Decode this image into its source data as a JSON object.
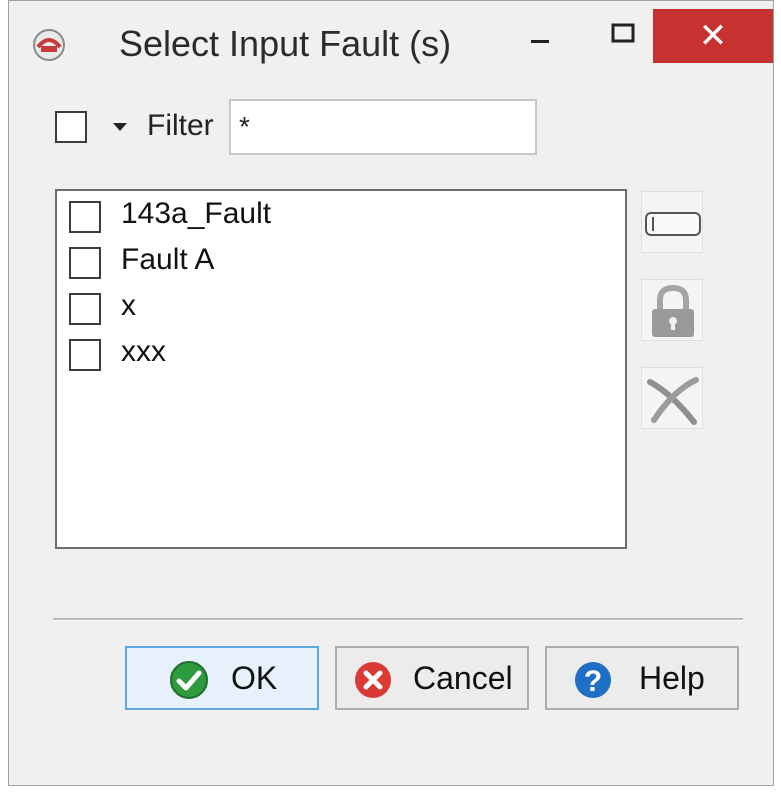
{
  "window": {
    "title": "Select Input Fault (s)",
    "icons": {
      "app": "fault-app-icon",
      "minimize": "minimize-icon",
      "maximize": "maximize-icon",
      "close": "close-icon"
    },
    "close_glyph": "✕",
    "close_color": "#c7312f"
  },
  "filter": {
    "label": "Filter",
    "value": "*",
    "select_all_checked": false
  },
  "list": {
    "items": [
      {
        "label": "143a_Fault",
        "checked": false
      },
      {
        "label": "Fault A",
        "checked": false
      },
      {
        "label": "x",
        "checked": false
      },
      {
        "label": "xxx",
        "checked": false
      }
    ]
  },
  "side_tools": [
    {
      "icon": "rename-icon"
    },
    {
      "icon": "lock-icon"
    },
    {
      "icon": "delete-icon"
    }
  ],
  "buttons": {
    "ok": {
      "label": "OK",
      "icon": "checkmark-icon",
      "color": "#2e9a3e"
    },
    "cancel": {
      "label": "Cancel",
      "icon": "cancel-x-icon",
      "color": "#d93a35"
    },
    "help": {
      "label": "Help",
      "icon": "question-icon",
      "color": "#1f6fc7"
    }
  }
}
